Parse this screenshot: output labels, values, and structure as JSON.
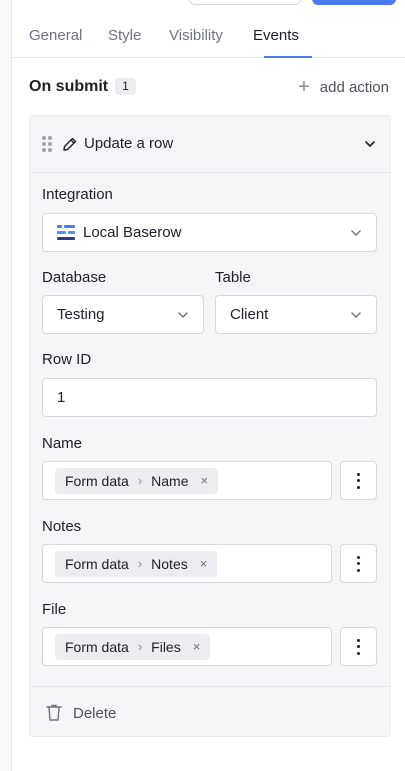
{
  "tabs": [
    {
      "label": "General"
    },
    {
      "label": "Style"
    },
    {
      "label": "Visibility"
    },
    {
      "label": "Events"
    }
  ],
  "active_tab": "Events",
  "event": {
    "title": "On submit",
    "count": "1",
    "add_action_label": "add action"
  },
  "action": {
    "title": "Update a row",
    "integration": {
      "label": "Integration",
      "value": "Local Baserow",
      "icon": "baserow-logo-icon"
    },
    "database": {
      "label": "Database",
      "value": "Testing"
    },
    "table": {
      "label": "Table",
      "value": "Client"
    },
    "row_id": {
      "label": "Row ID",
      "value": "1"
    },
    "fields": [
      {
        "label": "Name",
        "chip_source": "Form data",
        "chip_field": "Name"
      },
      {
        "label": "Notes",
        "chip_source": "Form data",
        "chip_field": "Notes"
      },
      {
        "label": "File",
        "chip_source": "Form data",
        "chip_field": "Files"
      }
    ],
    "delete_label": "Delete"
  },
  "colors": {
    "accent": "#4e79f0",
    "panel_bg": "#f5f5f7"
  }
}
